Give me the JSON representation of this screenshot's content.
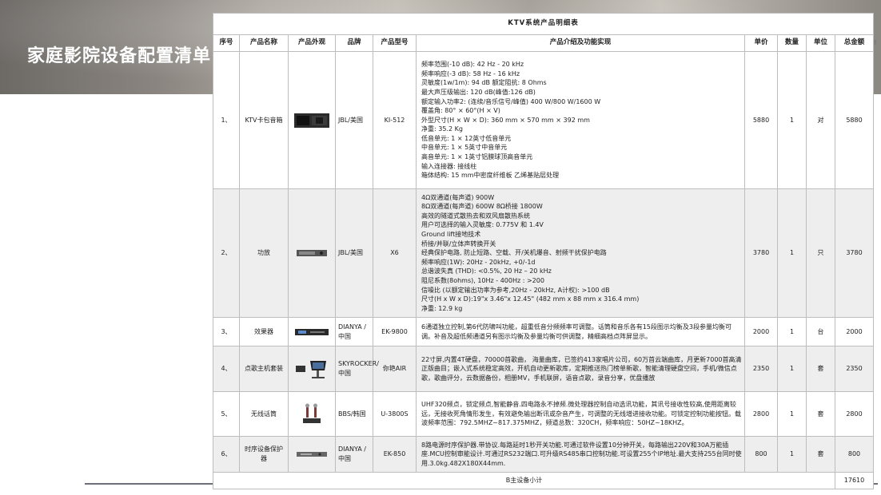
{
  "slide_title": "家庭影院设备配置清单",
  "table_title": "KTV系统产品明细表",
  "headers": {
    "index": "序号",
    "name": "产品名称",
    "appearance": "产品外观",
    "brand": "品牌",
    "model": "产品型号",
    "description": "产品介绍及功能实现",
    "price": "单价",
    "qty": "数量",
    "unit": "单位",
    "total": "总金额"
  },
  "rows": [
    {
      "index": "1、",
      "name": "KTV卡包音箱",
      "icon": "speaker-icon",
      "brand": "JBL/美国",
      "model": "KI-512",
      "desc": [
        "频率范围(-10 dB): 42 Hz - 20 kHz",
        "频率响应(-3 dB): 58 Hz - 16 kHz",
        "灵敏度(1w/1m): 94 dB    额定阻抗: 8 Ohms",
        "最大声压级输出: 120 dB(峰值:126 dB)",
        "额定输入功率2: (连续/音乐信号/峰值) 400 W/800 W/1600 W",
        "覆盖角: 80° × 60°(H × V)",
        "外型尺寸(H × W × D): 360 mm × 570 mm × 392 mm",
        "净重: 35.2 Kg",
        "低音单元: 1 × 12英寸低音单元",
        "中音单元: 1 × 5英寸中音单元",
        "高音单元: 1 × 1英寸铝膜球顶高音单元",
        "输入连接器: 接线柱",
        "箱体结构: 15 mm中密度纤维板 乙烯基贴层处理"
      ],
      "price": "5880",
      "qty": "1",
      "unit": "对",
      "total": "5880"
    },
    {
      "index": "2、",
      "name": "功放",
      "icon": "amplifier-icon",
      "brand": "JBL/美国",
      "model": "X6",
      "desc": [
        "4Ω双通道(每声道) 900W",
        "8Ω双通道(每声道) 600W    8Ω桥接 1800W",
        "高效的隧道式散热去和双风扇散热系统",
        "用户可选择的输入灵敏度: 0.775V 和 1.4V",
        "Ground lift接地技术",
        "桥接/并联/立体声转换开关",
        "经典保护电路, 防止短路、空载、开/关机爆音、射频干扰保护电路",
        "频率响应(1W): 20Hz - 20kHz, +0/-1d",
        "总谐波失真 (THD): <0.5%, 20 Hz – 20 kHz",
        "阻尼系数(8ohms), 10Hz - 400Hz : >200",
        "信噪比 (以额定输出功率为参考,20Hz - 20kHz, A计权): >100 dB",
        "尺寸(H x W x D):19\"x 3.46\"x 12.45\" (482 mm x 88 mm x 316.4 mm)",
        "净重:    12.9 kg"
      ],
      "price": "3780",
      "qty": "1",
      "unit": "只",
      "total": "3780"
    },
    {
      "index": "3、",
      "name": "效果器",
      "icon": "effects-processor-icon",
      "brand": "DIANYA /中国",
      "model": "EK-9800",
      "desc": [
        "6通道独立控制,第6代防啸叫功能，超重低音分频频率可调整。话筒和音乐各有15段图示均衡及3段参量均衡可调。补音及超低频通道另有图示均衡及参量均衡可供调整，精细高档点阵屏显示。"
      ],
      "price": "2000",
      "qty": "1",
      "unit": "台",
      "total": "2000"
    },
    {
      "index": "4、",
      "name": "点歌主机套装",
      "icon": "karaoke-system-icon",
      "brand": "SKYROCKER/中国",
      "model": "你艳AIR",
      "desc": [
        "22寸屏,内置4T硬盘，70000首歌曲， 海量曲库，已签约413家唱片公司，60万首云端曲库，月更新7000首高清正版曲目；嵌入式系统稳定高效，开机自动更新歌库，定期推送热门榜单新歌，智能清理硬盘空间，手机/微信点歌，歌曲评分，云数据备份，相册MV，手机联屏，语音点歌，录音分享，优盘播放"
      ],
      "price": "2350",
      "qty": "1",
      "unit": "套",
      "total": "2350"
    },
    {
      "index": "5、",
      "name": "无线话筒",
      "icon": "wireless-microphone-icon",
      "brand": "BBS/韩国",
      "model": "U-3800S",
      "desc": [
        "UHF320频点，锁定频点,智能静音.四电路永不掉频.微处理器控制自动选讯功能，其讯号接收性较高,使用距离较远，无接收死角情形发生，有效避免输出断讯或杂音产生，可调整的无线增进接收功能。可锁定控制功能按钮。载波频率范围：792.5MHZ~817.375MHZ，频道总数：320CH，频率响应：50HZ~18KHZ。"
      ],
      "price": "2800",
      "qty": "1",
      "unit": "套",
      "total": "2800"
    },
    {
      "index": "6、",
      "name": "时序设备保护器",
      "icon": "power-sequencer-icon",
      "brand": "DIANYA /中国",
      "model": "EK-850",
      "desc": [
        "8路电源时序保护器.带协议.每路延时1秒开关功能.可通过软件设置10分钟开关，每路输出220V和30A万能插座.MCU控制审能设计.可通过RS232端口.可升级RS485串口控制功能.可设置255个IP地址.最大支持255台同时使用.3.0kg.482X180X44mm."
      ],
      "price": "800",
      "qty": "1",
      "unit": "套",
      "total": "800"
    }
  ],
  "subtotal_label": "B主设备小计",
  "subtotal_value": "17610"
}
